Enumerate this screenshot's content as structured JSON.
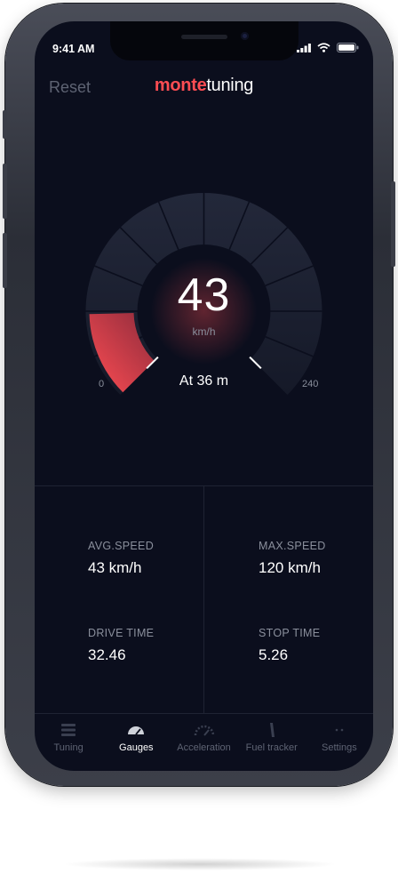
{
  "status_bar": {
    "time": "9:41 AM"
  },
  "header": {
    "reset_label": "Reset",
    "logo_part1": "monte",
    "logo_part2": "tuning"
  },
  "gauge": {
    "speed": "43",
    "unit": "km/h",
    "at_text": "At 36 m",
    "min_label": "0",
    "max_label": "240",
    "value": 43,
    "max": 240,
    "accent_color": "#ff4d53"
  },
  "stats": [
    {
      "label": "AVG.SPEED",
      "value": "43 km/h"
    },
    {
      "label": "MAX.SPEED",
      "value": "120 km/h"
    },
    {
      "label": "DRIVE TIME",
      "value": "32.46"
    },
    {
      "label": "STOP TIME",
      "value": "5.26"
    }
  ],
  "tabs": [
    {
      "label": "Tuning",
      "icon": "tuning-icon",
      "active": false
    },
    {
      "label": "Gauges",
      "icon": "gauge-icon",
      "active": true
    },
    {
      "label": "Acceleration",
      "icon": "speedometer-icon",
      "active": false
    },
    {
      "label": "Fuel tracker",
      "icon": "fuel-icon",
      "active": false
    },
    {
      "label": "Settings",
      "icon": "dots-icon",
      "active": false
    }
  ],
  "colors": {
    "background": "#0b0e1d",
    "accent": "#ff4d53",
    "muted": "#8a8f9c"
  }
}
